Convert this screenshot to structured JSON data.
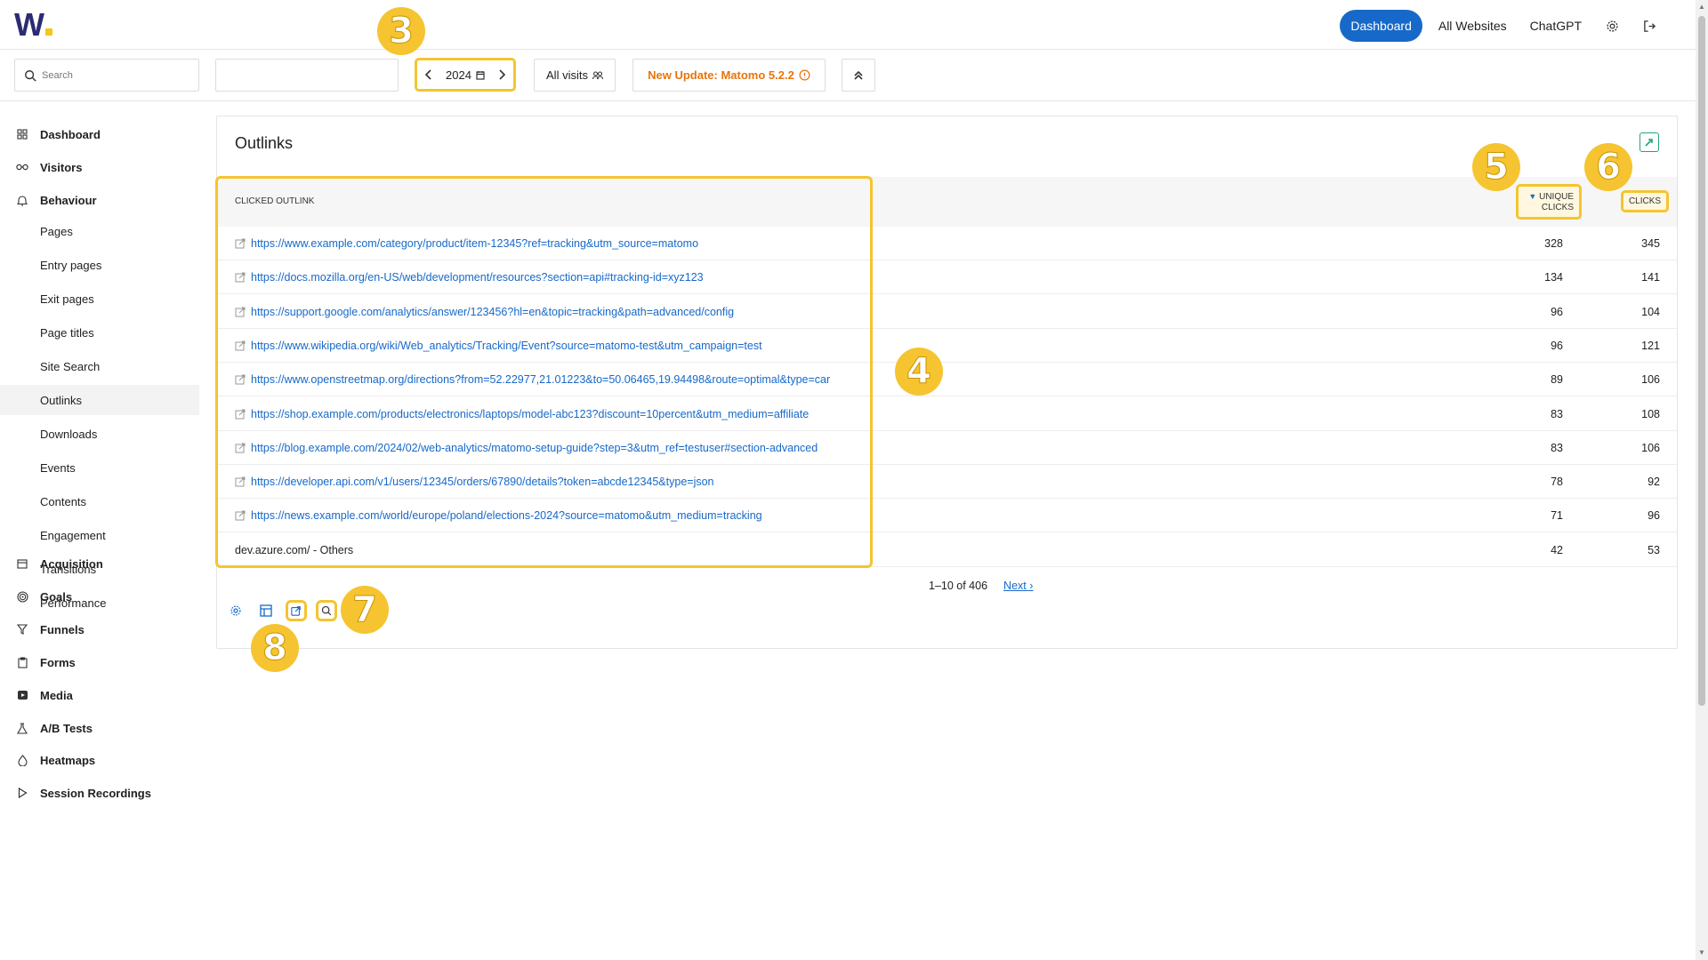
{
  "header": {
    "logo_text": "W",
    "nav": [
      "Dashboard",
      "All Websites",
      "ChatGPT"
    ]
  },
  "toolbar": {
    "search_placeholder": "Search",
    "date": "2024",
    "segment": "All visits",
    "update": "New Update: Matomo 5.2.2"
  },
  "sidebar": {
    "sections": [
      {
        "label": "Dashboard",
        "icon": "grid-icon"
      },
      {
        "label": "Visitors",
        "icon": "glasses-icon"
      },
      {
        "label": "Behaviour",
        "icon": "bell-icon"
      },
      {
        "label": "Acquisition",
        "icon": "calendar-icon"
      },
      {
        "label": "Goals",
        "icon": "target-icon"
      },
      {
        "label": "Funnels",
        "icon": "funnel-icon"
      },
      {
        "label": "Forms",
        "icon": "clipboard-icon"
      },
      {
        "label": "Media",
        "icon": "media-icon"
      },
      {
        "label": "A/B Tests",
        "icon": "flask-icon"
      },
      {
        "label": "Heatmaps",
        "icon": "flame-icon"
      },
      {
        "label": "Session Recordings",
        "icon": "play-icon"
      }
    ],
    "behaviour_items": [
      "Pages",
      "Entry pages",
      "Exit pages",
      "Page titles",
      "Site Search",
      "Outlinks",
      "Downloads",
      "Events",
      "Contents",
      "Engagement",
      "Transitions",
      "Performance"
    ]
  },
  "widget": {
    "title": "Outlinks",
    "columns": {
      "label": "CLICKED OUTLINK",
      "unique_line1": "UNIQUE",
      "unique_line2": "CLICKS",
      "clicks": "CLICKS"
    },
    "rows": [
      {
        "label": "https://www.example.com/category/product/item-12345?ref=tracking&utm_source=matomo",
        "unique": "328",
        "clicks": "345",
        "link": true
      },
      {
        "label": "https://docs.mozilla.org/en-US/web/development/resources?section=api#tracking-id=xyz123",
        "unique": "134",
        "clicks": "141",
        "link": true
      },
      {
        "label": "https://support.google.com/analytics/answer/123456?hl=en&topic=tracking&path=advanced/config",
        "unique": "96",
        "clicks": "104",
        "link": true
      },
      {
        "label": "https://www.wikipedia.org/wiki/Web_analytics/Tracking/Event?source=matomo-test&utm_campaign=test",
        "unique": "96",
        "clicks": "121",
        "link": true
      },
      {
        "label": "https://www.openstreetmap.org/directions?from=52.22977,21.01223&to=50.06465,19.94498&route=optimal&type=car",
        "unique": "89",
        "clicks": "106",
        "link": true
      },
      {
        "label": "https://shop.example.com/products/electronics/laptops/model-abc123?discount=10percent&utm_medium=affiliate",
        "unique": "83",
        "clicks": "108",
        "link": true
      },
      {
        "label": "https://blog.example.com/2024/02/web-analytics/matomo-setup-guide?step=3&utm_ref=testuser#section-advanced",
        "unique": "83",
        "clicks": "106",
        "link": true
      },
      {
        "label": "https://developer.api.com/v1/users/12345/orders/67890/details?token=abcde12345&type=json",
        "unique": "78",
        "clicks": "92",
        "link": true
      },
      {
        "label": "https://news.example.com/world/europe/poland/elections-2024?source=matomo&utm_medium=tracking",
        "unique": "71",
        "clicks": "96",
        "link": true
      },
      {
        "label": "dev.azure.com/ - Others",
        "unique": "42",
        "clicks": "53",
        "link": false
      }
    ],
    "pagination": {
      "range": "1–10 of 406",
      "next": "Next ›"
    }
  },
  "markers": [
    "3",
    "4",
    "5",
    "6",
    "7",
    "8"
  ],
  "colors": {
    "accent": "#1769c9",
    "highlight": "#f5c430",
    "update": "#e8740c"
  }
}
